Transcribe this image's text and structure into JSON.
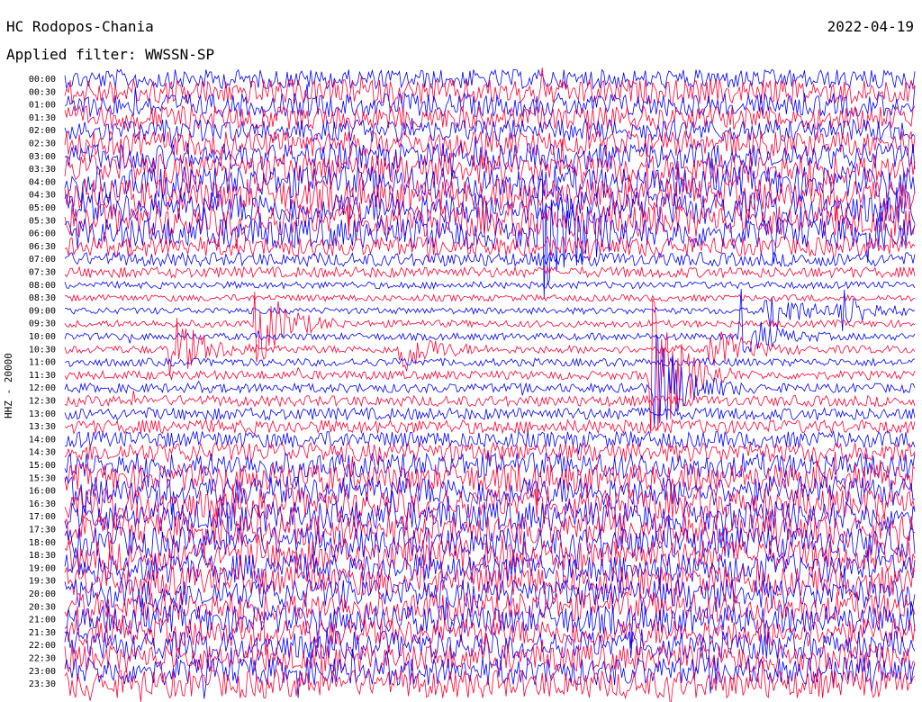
{
  "header": {
    "station": "HC Rodopos-Chania",
    "date": "2022-04-19",
    "filter": "Applied filter: WWSSN-SP"
  },
  "chart_data": {
    "type": "line",
    "ylabel": "HHZ - 20000",
    "rows": [
      "00:00",
      "00:30",
      "01:00",
      "01:30",
      "02:00",
      "02:30",
      "03:00",
      "03:30",
      "04:00",
      "04:30",
      "05:00",
      "05:30",
      "06:00",
      "06:30",
      "07:00",
      "07:30",
      "08:00",
      "08:30",
      "09:00",
      "09:30",
      "10:00",
      "10:30",
      "11:00",
      "11:30",
      "12:00",
      "12:30",
      "13:00",
      "13:30",
      "14:00",
      "14:30",
      "15:00",
      "15:30",
      "16:00",
      "16:30",
      "17:00",
      "17:30",
      "18:00",
      "18:30",
      "19:00",
      "19:30",
      "20:00",
      "20:30",
      "21:00",
      "21:30",
      "22:00",
      "22:30",
      "23:00",
      "23:30"
    ],
    "noise_level": [
      0.55,
      0.75,
      0.7,
      0.7,
      0.65,
      0.75,
      0.8,
      0.95,
      1.0,
      1.0,
      1.0,
      1.0,
      0.95,
      0.55,
      0.35,
      0.25,
      0.12,
      0.1,
      0.1,
      0.12,
      0.12,
      0.15,
      0.15,
      0.18,
      0.2,
      0.25,
      0.3,
      0.35,
      0.45,
      0.55,
      0.75,
      0.85,
      0.9,
      0.95,
      0.95,
      0.95,
      0.95,
      0.95,
      0.9,
      0.9,
      0.9,
      0.9,
      0.9,
      0.85,
      0.85,
      0.85,
      0.85,
      0.85
    ],
    "series_colors": [
      "#0000ff",
      "#ff0033"
    ],
    "events": [
      {
        "row": "06:00",
        "minute": 17,
        "amplitude": 1.6
      },
      {
        "row": "09:30",
        "minute": 7,
        "amplitude": 1.0
      },
      {
        "row": "10:30",
        "minute": 4,
        "amplitude": 0.8
      },
      {
        "row": "10:30",
        "minute": 12,
        "amplitude": 0.6
      },
      {
        "row": "10:00",
        "minute": 24,
        "amplitude": 0.6
      },
      {
        "row": "11:30",
        "minute": 20.8,
        "amplitude": 2.2
      },
      {
        "row": "12:00",
        "minute": 21,
        "amplitude": 1.4
      },
      {
        "row": "10:30",
        "minute": 23,
        "amplitude": 0.6
      },
      {
        "row": "09:00",
        "minute": 25,
        "amplitude": 0.6
      },
      {
        "row": "09:00",
        "minute": 27.5,
        "amplitude": 0.5
      }
    ]
  }
}
